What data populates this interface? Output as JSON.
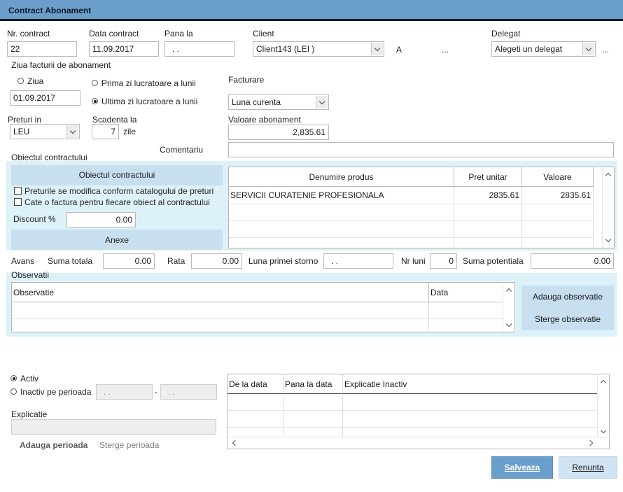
{
  "window": {
    "title": "Contract Abonament"
  },
  "header": {
    "nr_contract_label": "Nr. contract",
    "nr_contract_value": "22",
    "data_contract_label": "Data contract",
    "data_contract_value": "11.09.2017",
    "pana_la_label": "Pana la",
    "pana_la_value": ". .",
    "client_label": "Client",
    "client_value": "Client143 (LEI )",
    "client_extra_a": "A",
    "client_more": "...",
    "delegat_label": "Delegat",
    "delegat_value": "Alegeti un delegat",
    "delegat_more": "..."
  },
  "billing_day": {
    "label": "Ziua facturii de abonament",
    "ziua_label": "Ziua",
    "ziua_value": "01.09.2017",
    "first_workday_label": "Prima zi lucratoare a lunii",
    "last_workday_label": "Ultima zi lucratoare a lunii",
    "facturare_label": "Facturare",
    "facturare_value": "Luna curenta"
  },
  "pricing": {
    "preturi_label": "Preturi in",
    "currency": "LEU",
    "scadenta_label": "Scadenta la",
    "scadenta_value": "7",
    "scadenta_unit": "zile",
    "valoare_label": "Valoare abonament",
    "valoare_value": "2,835.61",
    "comentariu_label": "Comentariu",
    "comentariu_value": ""
  },
  "object_section": {
    "label": "Obiectul contractului",
    "button_label": "Obiectul contractului",
    "check_prices": "Preturile se modifica conform  catalogului de preturi",
    "check_invoice": "Cate o factura pentru fiecare obiect al contractului",
    "discount_label": "Discount %",
    "discount_value": "0.00",
    "anexe_label": "Anexe",
    "grid": {
      "columns": [
        "Denumire produs",
        "Pret unitar",
        "Valoare"
      ],
      "rows": [
        {
          "produs": "SERVICII CURATENIE PROFESIONALA",
          "pret": "2835.61",
          "valoare": "2835.61"
        }
      ]
    }
  },
  "avans": {
    "label": "Avans",
    "suma_totala_label": "Suma totala",
    "suma_totala_value": "0.00",
    "rata_label": "Rata",
    "rata_value": "0.00",
    "luna_storno_label": "Luna primei storno",
    "luna_storno_value": ". .",
    "nr_luni_label": "Nr luni",
    "nr_luni_value": "0",
    "suma_potentiala_label": "Suma potentiala",
    "suma_potentiala_value": "0.00"
  },
  "observatii": {
    "label": "Observatii",
    "columns": [
      "Observatie",
      "Data"
    ],
    "add_label": "Adauga observatie",
    "delete_label": "Sterge observatie"
  },
  "status": {
    "activ_label": "Activ",
    "inactiv_label": "Inactiv pe perioada",
    "inactiv_from": ". .",
    "inactiv_to": ". .",
    "separator": "-",
    "explicatie_label": "Explicatie",
    "explicatie_value": "",
    "add_period_label": "Adauga perioada",
    "delete_period_label": "Sterge perioada",
    "grid_columns": [
      "De la data",
      "Pana la data",
      "Explicatie Inactiv"
    ]
  },
  "footer": {
    "save_label": "Salveaza",
    "cancel_label": "Renunta"
  },
  "colors": {
    "titlebar": "#6a9fcb",
    "panel": "#ddf2f8",
    "button_light": "#c8dff0",
    "save_button": "#6a9fcb"
  }
}
